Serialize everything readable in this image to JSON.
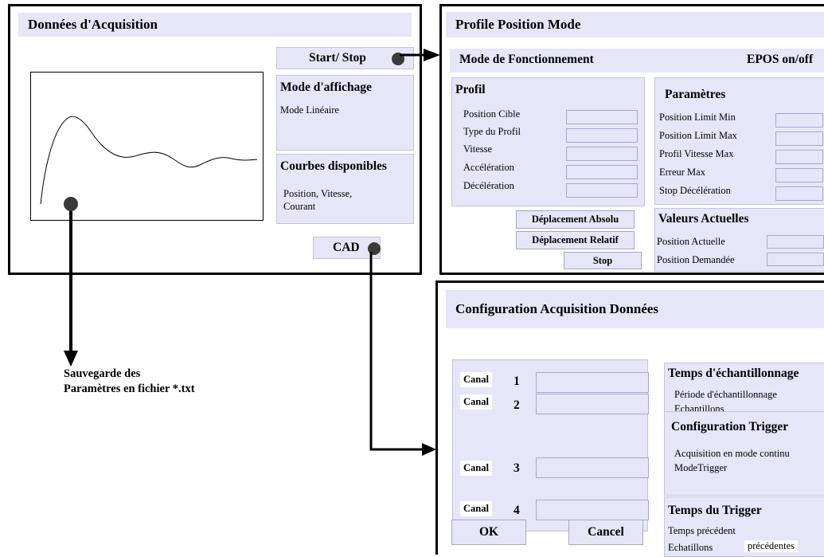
{
  "acquisition": {
    "title": "Données d'Acquisition",
    "start_stop": "Start/ Stop",
    "mode_title": "Mode d'affichage",
    "mode_value": "Mode Linéaire",
    "curves_title": "Courbes disponibles",
    "curves_value_1": "Position, Vitesse,",
    "curves_value_2": "Courant",
    "cad": "CAD"
  },
  "save_note": {
    "line1": "Sauvegarde des",
    "line2": "Paramètres en fichier *.txt"
  },
  "profile": {
    "title": "Profile Position Mode",
    "mode_label": "Mode de Fonctionnement",
    "epos_toggle": "EPOS on/off",
    "profil_title": "Profil",
    "profil_fields": [
      "Position Cible",
      "Type du Profil",
      "Vitesse",
      "Accélération",
      "Décélération"
    ],
    "params_title": "Paramètres",
    "params_fields": [
      "Position Limit Min",
      "Position Limit Max",
      "Profil Vitesse Max",
      "Erreur Max",
      "Stop Décélération"
    ],
    "actual_title": "Valeurs Actuelles",
    "actual_fields": [
      "Position Actuelle",
      "Position Demandée"
    ],
    "btn_absolu": "Déplacement Absolu",
    "btn_relatif": "Déplacement Relatif",
    "btn_stop": "Stop"
  },
  "config": {
    "title": "Configuration Acquisition Données",
    "canal_label": "Canal",
    "canals": [
      "1",
      "2",
      "3",
      "4"
    ],
    "sampling_title": "Temps d'échantillonnage",
    "sampling_1": "Période d'échantillonnage",
    "sampling_2": "Echantillons",
    "trigger_title": "Configuration Trigger",
    "trigger_1": "Acquisition en mode continu",
    "trigger_2": "ModeTrigger",
    "trigger_time_title": "Temps du Trigger",
    "trigger_time_1": "Temps précédent",
    "trigger_time_2a": "Echatillons",
    "trigger_time_2b": "précédentes",
    "ok": "OK",
    "cancel": "Cancel"
  }
}
